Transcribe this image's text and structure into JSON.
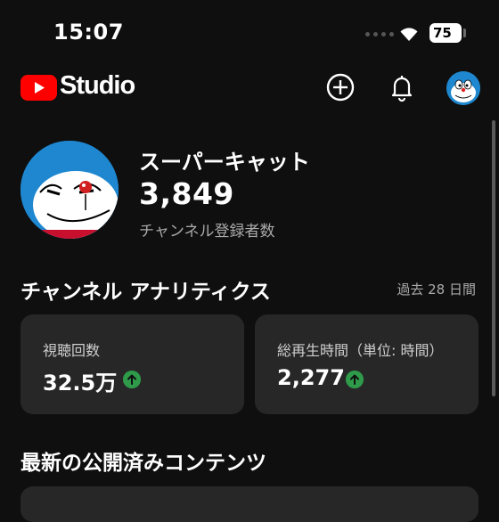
{
  "status_bar": {
    "time": "15:07",
    "battery": "75"
  },
  "app": {
    "brand": "Studio"
  },
  "header": {
    "create_icon": "plus-circle-icon",
    "notifications_icon": "bell-icon"
  },
  "channel": {
    "name": "スーパーキャット",
    "subscribers": "3,849",
    "subscribers_label": "チャンネル登録者数"
  },
  "analytics": {
    "title": "チャンネル アナリティクス",
    "period": "過去 28 日間",
    "cards": [
      {
        "label": "視聴回数",
        "value": "32.5万",
        "trend": "up"
      },
      {
        "label": "総再生時間（単位: 時間）",
        "value": "2,277",
        "trend": "up"
      }
    ]
  },
  "latest": {
    "title": "最新の公開済みコンテンツ"
  },
  "colors": {
    "background": "#0f0f0f",
    "card": "#272727",
    "brand_red": "#ff0000",
    "trend_up": "#2e9a4a",
    "secondary_text": "#aaaaaa"
  }
}
